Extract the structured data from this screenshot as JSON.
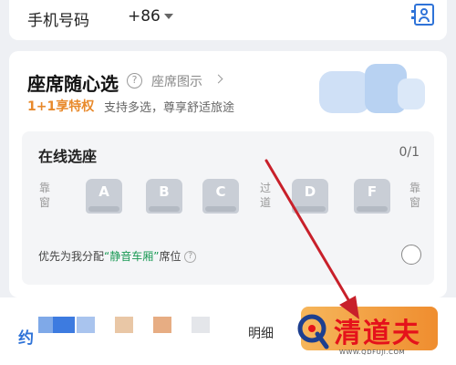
{
  "phone": {
    "label": "手机号码",
    "country_code": "+86"
  },
  "seat_section": {
    "title": "座席随心选",
    "help_glyph": "?",
    "seat_map_link": "座席图示",
    "privilege_badge": "1+1享特权",
    "privilege_desc": "支持多选，尊享舒适旅途"
  },
  "online_selection": {
    "title": "在线选座",
    "count": "0/1",
    "window_left": "靠窗",
    "aisle": "过道",
    "window_right": "靠窗",
    "seats": [
      "A",
      "B",
      "C",
      "D",
      "F"
    ],
    "quiet_prefix": "优先为我分配",
    "quiet_highlight": "“静音车厢”",
    "quiet_suffix": "席位",
    "quiet_help": "?"
  },
  "bottom_bar": {
    "label": "约",
    "detail_link": "明细"
  },
  "watermark": {
    "text": "清道夫",
    "url": "WWW.QDFUJI.COM"
  },
  "colors": {
    "accent_blue": "#2f73d8",
    "orange": "#ef8d2f",
    "green_highlight": "#1a9a55",
    "annotation_arrow": "#c8202a"
  }
}
